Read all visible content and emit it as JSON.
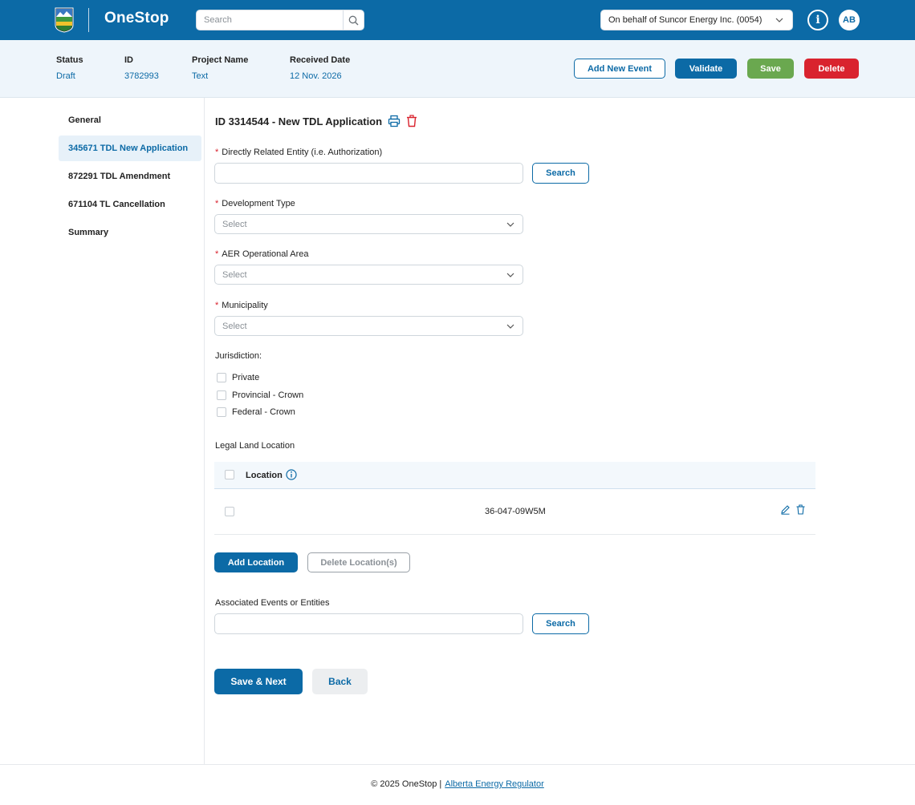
{
  "header": {
    "brand": "OneStop",
    "search_placeholder": "Search",
    "behalf": "On behalf of Suncor Energy Inc. (0054)",
    "info_glyph": "i",
    "avatar_initials": "AB",
    "icons": [
      "alberta-shield-logo",
      "search-icon",
      "chevron-down-icon",
      "info-icon"
    ]
  },
  "summary": {
    "status_label": "Status",
    "status_value": "Draft",
    "id_label": "ID",
    "id_value": "3782993",
    "project_label": "Project Name",
    "project_value": "Text",
    "received_label": "Received Date",
    "received_value": "12 Nov. 2026",
    "add_event": "Add New Event",
    "validate": "Validate",
    "save": "Save",
    "delete": "Delete"
  },
  "sidebar": {
    "items": [
      {
        "label": "General",
        "active": false
      },
      {
        "label": "345671 TDL New Application",
        "active": true
      },
      {
        "label": "872291 TDL Amendment",
        "active": false
      },
      {
        "label": "671104 TL Cancellation",
        "active": false
      },
      {
        "label": "Summary",
        "active": false
      }
    ]
  },
  "form": {
    "title": "ID 3314544 - New TDL Application",
    "required_mark": "*",
    "entity_label": "Directly Related Entity (i.e. Authorization)",
    "entity_value": "",
    "search_button": "Search",
    "development_label": "Development Type",
    "development_value": "Select",
    "aer_label": "AER Operational Area",
    "aer_value": "Select",
    "municipality_label": "Municipality",
    "municipality_value": "Select",
    "jurisdiction_label": "Jurisdiction:",
    "jurisdiction_options": [
      "Private",
      "Provincial - Crown",
      "Federal - Crown"
    ],
    "legal_land_label": "Legal Land Location",
    "table": {
      "column": "Location",
      "rows": [
        "36-047-09W5M"
      ]
    },
    "add_location": "Add Location",
    "delete_locations": "Delete Location(s)",
    "associated_label": "Associated Events or Entities",
    "associated_value": "",
    "save_next": "Save & Next",
    "back": "Back"
  },
  "footer": {
    "copyright": "© 2025 OneStop |",
    "link": "Alberta Energy Regulator"
  },
  "colors": {
    "primary": "#0c6aa6",
    "green": "#6aa84f",
    "red": "#d9232e"
  }
}
